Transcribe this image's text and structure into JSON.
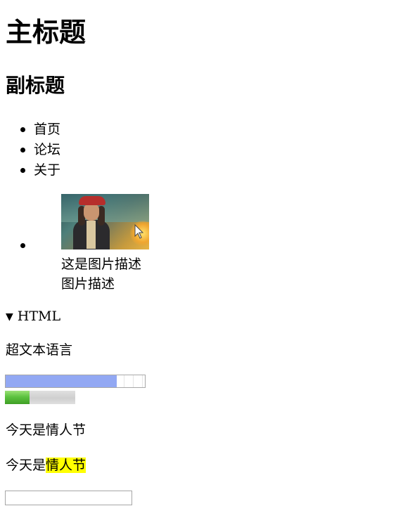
{
  "headings": {
    "main_title": "主标题",
    "sub_title": "副标题"
  },
  "nav": {
    "items": [
      {
        "label": "首页"
      },
      {
        "label": "论坛"
      },
      {
        "label": "关于"
      }
    ]
  },
  "figure": {
    "image_subject": "pirate-portrait",
    "caption_line1": "这是图片描述",
    "caption_line2": "图片描述"
  },
  "details": {
    "summary": "HTML",
    "expanded": true,
    "content": "超文本语言"
  },
  "progress": {
    "value_fraction": 0.8,
    "fill_color": "#92a8f3"
  },
  "meter": {
    "value_fraction": 0.35,
    "fill_color": "#5dc340"
  },
  "paragraphs": {
    "plain": "今天是情人节",
    "highlight_prefix": "今天是",
    "highlight_marked": "情人节",
    "highlight_color": "#ffff00"
  },
  "input": {
    "value": "",
    "placeholder": ""
  }
}
